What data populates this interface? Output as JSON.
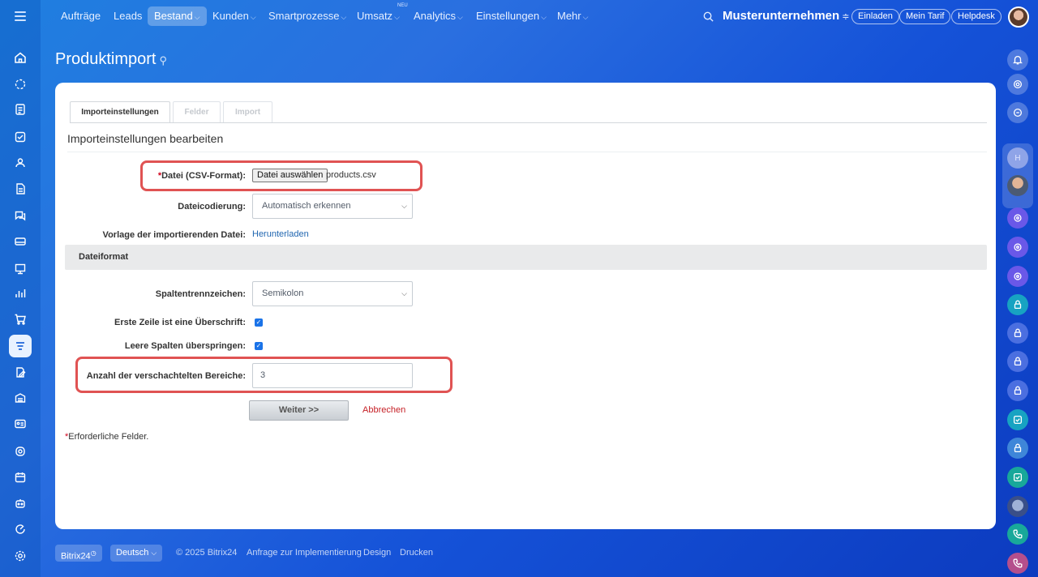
{
  "topnav": {
    "items": [
      {
        "label": "Aufträge",
        "chevron": false
      },
      {
        "label": "Leads",
        "chevron": false
      },
      {
        "label": "Bestand",
        "chevron": true,
        "active": true
      },
      {
        "label": "Kunden",
        "chevron": true
      },
      {
        "label": "Smartprozesse",
        "chevron": true
      },
      {
        "label": "Umsatz",
        "chevron": true
      },
      {
        "label": "Analytics",
        "chevron": true
      },
      {
        "label": "Einstellungen",
        "chevron": true
      },
      {
        "label": "Mehr",
        "chevron": true
      }
    ],
    "neu_badge": "NEU",
    "company": "Musterunternehmen",
    "invite": "Einladen",
    "plan": "Mein Tarif",
    "helpdesk": "Helpdesk"
  },
  "page": {
    "title": "Produktimport"
  },
  "tabs": [
    {
      "label": "Importeinstellungen",
      "active": true
    },
    {
      "label": "Felder",
      "active": false
    },
    {
      "label": "Import",
      "active": false
    }
  ],
  "form": {
    "section_title": "Importeinstellungen bearbeiten",
    "file_label": "Datei (CSV-Format):",
    "file_button": "Datei auswählen",
    "file_name": "products.csv",
    "encoding_label": "Dateicodierung:",
    "encoding_value": "Automatisch erkennen",
    "template_label": "Vorlage der importierenden Datei:",
    "template_link": "Herunterladen",
    "format_header": "Dateiformat",
    "separator_label": "Spaltentrennzeichen:",
    "separator_value": "Semikolon",
    "header_row_label": "Erste Zeile ist eine Überschrift:",
    "header_row_checked": true,
    "skip_empty_label": "Leere Spalten überspringen:",
    "skip_empty_checked": true,
    "nested_label": "Anzahl der verschachtelten Bereiche:",
    "nested_value": "3",
    "next_button": "Weiter >>",
    "cancel_link": "Abbrechen",
    "required_note": "Erforderliche Felder."
  },
  "footer": {
    "brand": "Bitrix24",
    "language": "Deutsch",
    "copyright": "© 2025 Bitrix24",
    "links": [
      "Anfrage zur Implementierung",
      "Design",
      "Drucken"
    ]
  },
  "colors": {
    "accent": "#1a73e8",
    "highlight": "#e05353",
    "required": "#d0021b",
    "cancel": "#c62026"
  }
}
